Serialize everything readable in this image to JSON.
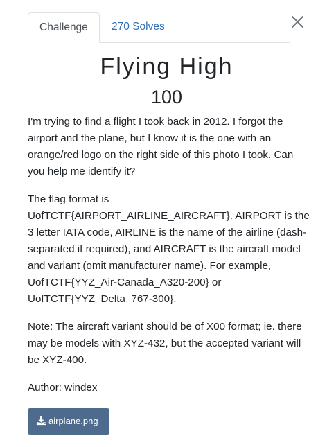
{
  "tabs": [
    {
      "label": "Challenge",
      "active": true
    },
    {
      "label": "270 Solves",
      "active": false
    }
  ],
  "close_icon": "close-icon",
  "challenge": {
    "name": "Flying High",
    "points": "100",
    "description": [
      "I'm trying to find a flight I took back in 2012. I forgot the airport and the plane, but I know it is the one with an orange/red logo on the right side of this photo I took. Can you help me identify it?",
      "The flag format is UofTCTF{AIRPORT_AIRLINE_AIRCRAFT}. AIRPORT is the 3 letter IATA code, AIRLINE is the name of the airline (dash-separated if required), and AIRCRAFT is the aircraft model and variant (omit manufacturer name). For example, UofTCTF{YYZ_Air-Canada_A320-200} or UofTCTF{YYZ_Delta_767-300}.",
      "Note: The aircraft variant should be of X00 format; ie. there may be models with XYZ-432, but the accepted variant will be XYZ-400.",
      "Author: windex"
    ]
  },
  "file": {
    "label": "airplane.png",
    "icon": "download-icon",
    "button_color": "#4e6b8d"
  },
  "colors": {
    "link": "#2f6fb5",
    "text": "#212529",
    "border": "#dee2e6"
  }
}
